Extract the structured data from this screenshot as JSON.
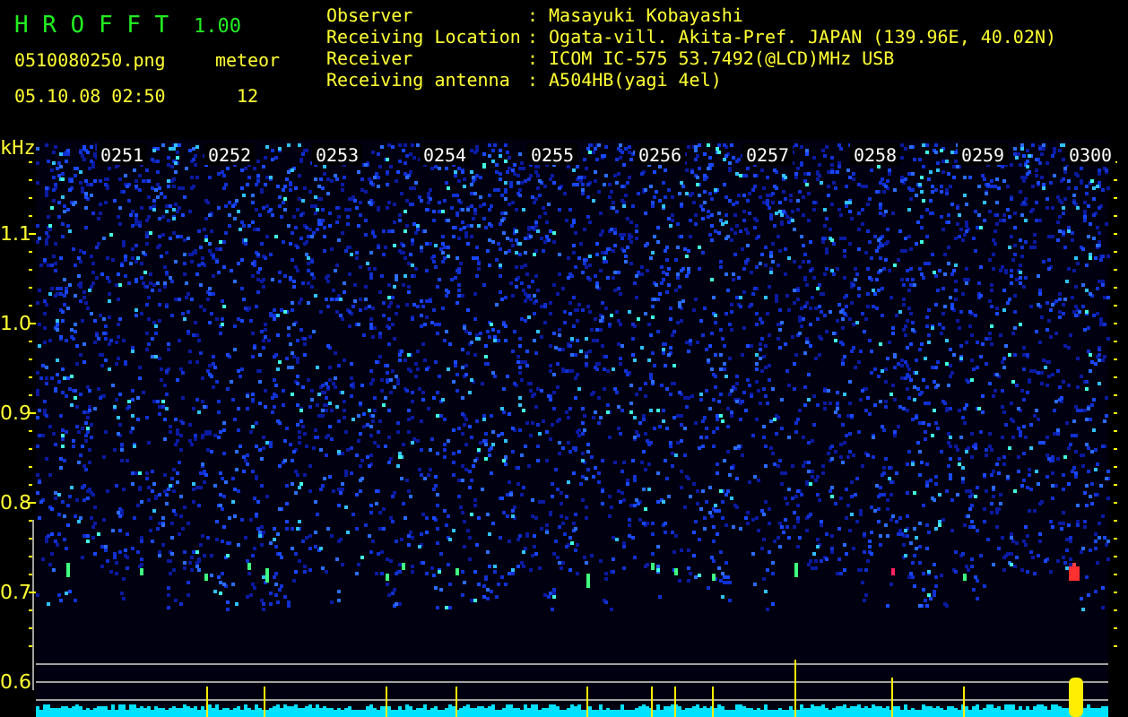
{
  "app": {
    "title": "H R O F F T",
    "version": "1.00"
  },
  "file": {
    "name": "0510080250.png",
    "datetime": "05.10.08 02:50"
  },
  "meteor": {
    "label": "meteor",
    "count": "12"
  },
  "info": [
    {
      "label": "Observer",
      "value": ": Masayuki Kobayashi"
    },
    {
      "label": "Receiving Location",
      "value": ": Ogata-vill. Akita-Pref. JAPAN (139.96E, 40.02N)"
    },
    {
      "label": "Receiver",
      "value": ": ICOM IC-575 53.7492(@LCD)MHz USB"
    },
    {
      "label": "Receiving antenna",
      "value": ": A504HB(yagi 4el)"
    }
  ],
  "spectrogram": {
    "unit": "kHz",
    "frequency_labels": [
      "1.1",
      "1.0",
      "0.9",
      "0.8",
      "0.7",
      "0.6"
    ],
    "time_labels": [
      "0251",
      "0252",
      "0253",
      "0254",
      "0255",
      "0256",
      "0257",
      "0258",
      "0259",
      "0300"
    ]
  }
}
